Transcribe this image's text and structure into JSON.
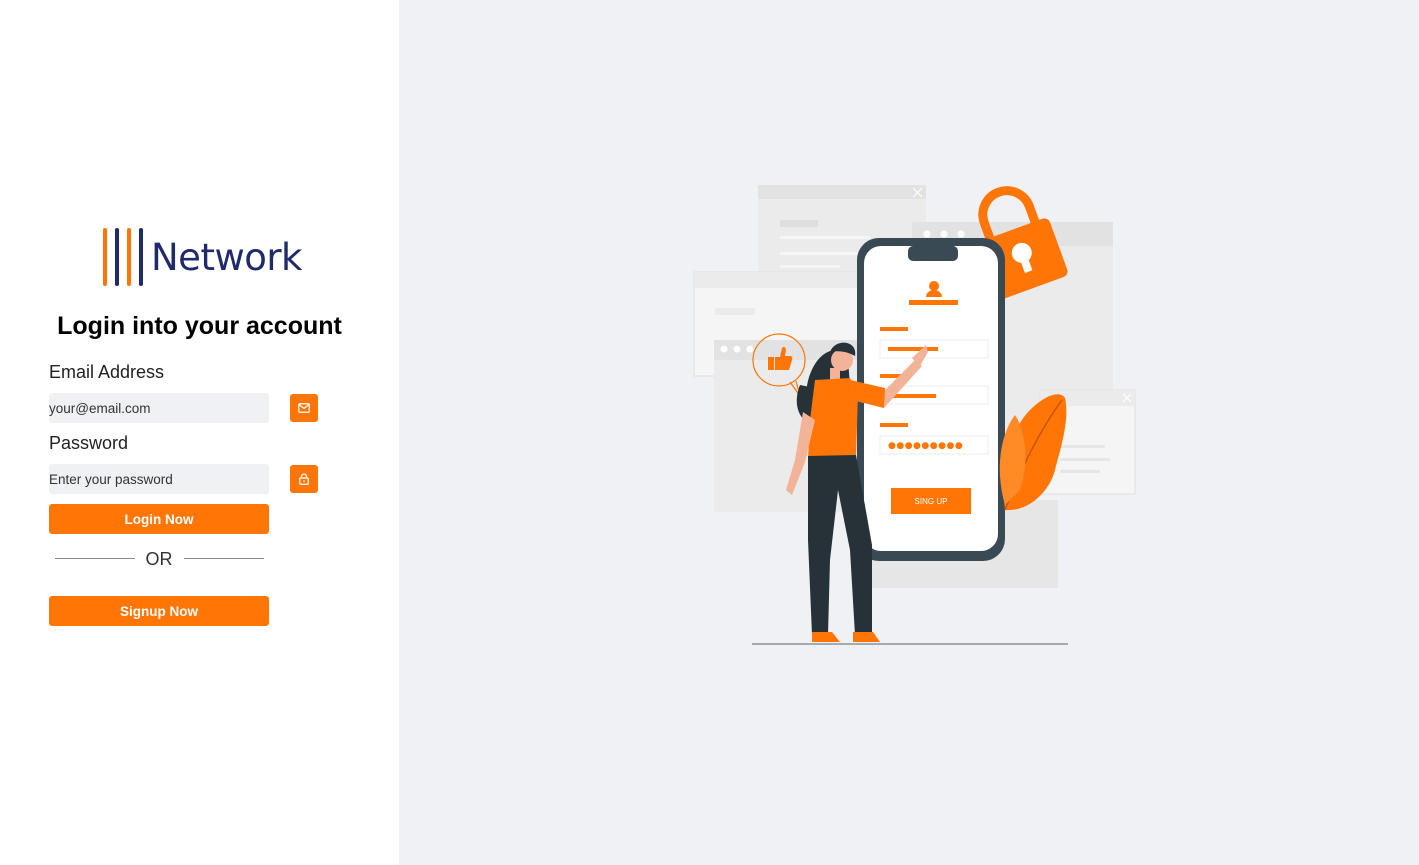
{
  "brand": {
    "name": "Network",
    "bar_colors": [
      "#ff7606",
      "#1f2a6b",
      "#ff7606",
      "#1f2a6b"
    ]
  },
  "login": {
    "title": "Login into your account",
    "email_label": "Email Address",
    "email_placeholder": "your@email.com",
    "email_icon": "mail-icon",
    "password_label": "Password",
    "password_placeholder": "Enter your password",
    "password_icon": "lock-icon",
    "login_button": "Login Now",
    "or_text": "OR",
    "signup_button": "Signup Now"
  },
  "illustration": {
    "phone_button": "SING UP",
    "password_mask": "●●●●●●●●●"
  },
  "colors": {
    "accent": "#ff7606",
    "brand_navy": "#1f2a6b",
    "panel_bg": "#f0f1f5"
  }
}
